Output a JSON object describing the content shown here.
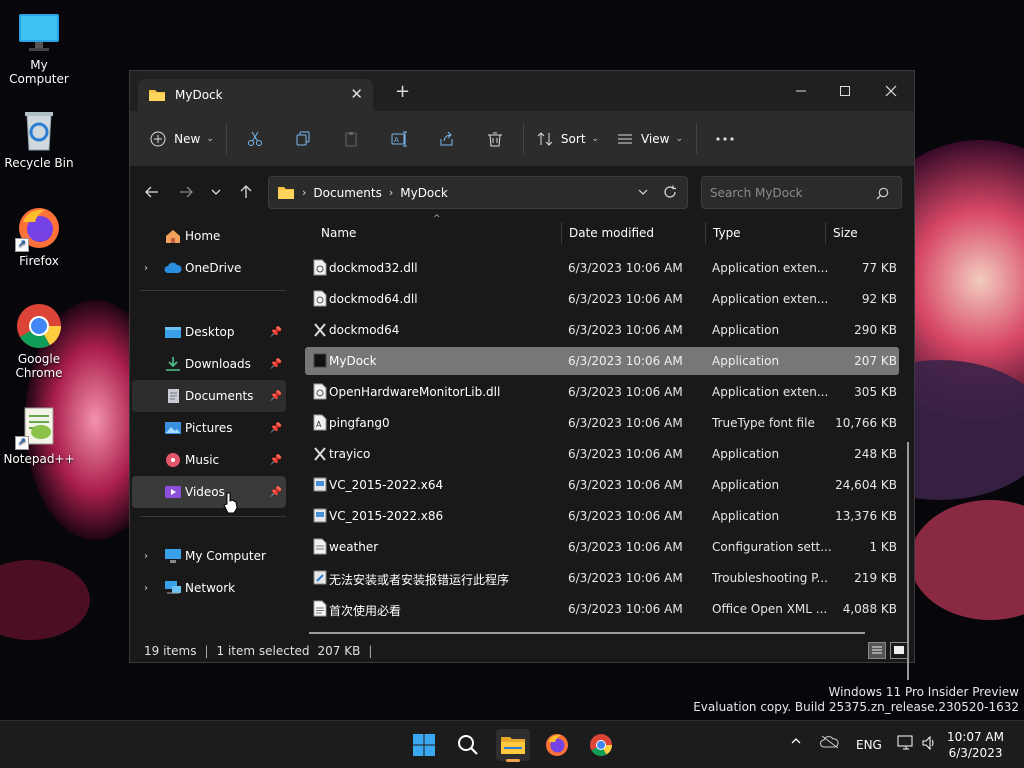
{
  "desktop": {
    "icons": [
      {
        "label": "My Computer"
      },
      {
        "label": "Recycle Bin"
      },
      {
        "label": "Firefox"
      },
      {
        "label": "Google Chrome"
      },
      {
        "label": "Notepad++"
      }
    ]
  },
  "window": {
    "tab_title": "MyDock",
    "toolbar": {
      "new_label": "New",
      "sort_label": "Sort",
      "view_label": "View"
    },
    "address": {
      "crumbs": [
        "Documents",
        "MyDock"
      ]
    },
    "search": {
      "placeholder": "Search MyDock"
    },
    "nav": {
      "home": "Home",
      "onedrive": "OneDrive",
      "desktop": "Desktop",
      "downloads": "Downloads",
      "documents": "Documents",
      "pictures": "Pictures",
      "music": "Music",
      "videos": "Videos",
      "my_computer": "My Computer",
      "network": "Network"
    },
    "columns": {
      "name": "Name",
      "date": "Date modified",
      "type": "Type",
      "size": "Size"
    },
    "files": [
      {
        "name": "dockmod32.dll",
        "date": "6/3/2023 10:06 AM",
        "type": "Application exten...",
        "size": "77 KB",
        "icon": "dll-icon"
      },
      {
        "name": "dockmod64.dll",
        "date": "6/3/2023 10:06 AM",
        "type": "Application exten...",
        "size": "92 KB",
        "icon": "dll-icon"
      },
      {
        "name": "dockmod64",
        "date": "6/3/2023 10:06 AM",
        "type": "Application",
        "size": "290 KB",
        "icon": "tools-icon"
      },
      {
        "name": "MyDock",
        "date": "6/3/2023 10:06 AM",
        "type": "Application",
        "size": "207 KB",
        "icon": "app-icon"
      },
      {
        "name": "OpenHardwareMonitorLib.dll",
        "date": "6/3/2023 10:06 AM",
        "type": "Application exten...",
        "size": "305 KB",
        "icon": "dll-icon"
      },
      {
        "name": "pingfang0",
        "date": "6/3/2023 10:06 AM",
        "type": "TrueType font file",
        "size": "10,766 KB",
        "icon": "font-icon"
      },
      {
        "name": "trayico",
        "date": "6/3/2023 10:06 AM",
        "type": "Application",
        "size": "248 KB",
        "icon": "tools-icon"
      },
      {
        "name": "VC_2015-2022.x64",
        "date": "6/3/2023 10:06 AM",
        "type": "Application",
        "size": "24,604 KB",
        "icon": "installer-icon"
      },
      {
        "name": "VC_2015-2022.x86",
        "date": "6/3/2023 10:06 AM",
        "type": "Application",
        "size": "13,376 KB",
        "icon": "installer-icon"
      },
      {
        "name": "weather",
        "date": "6/3/2023 10:06 AM",
        "type": "Configuration sett...",
        "size": "1 KB",
        "icon": "config-icon"
      },
      {
        "name": "无法安装或者安装报错运行此程序",
        "date": "6/3/2023 10:06 AM",
        "type": "Troubleshooting P...",
        "size": "219 KB",
        "icon": "troubleshoot-icon"
      },
      {
        "name": "首次使用必看",
        "date": "6/3/2023 10:06 AM",
        "type": "Office Open XML ...",
        "size": "4,088 KB",
        "icon": "document-icon"
      }
    ],
    "selected_index": 3,
    "status": {
      "items": "19 items",
      "selected": "1 item selected",
      "selected_size": "207 KB"
    }
  },
  "watermark": {
    "line1": "Windows 11 Pro Insider Preview",
    "line2": "Evaluation copy. Build 25375.zn_release.230520-1632"
  },
  "taskbar": {
    "language": "ENG",
    "time": "10:07 AM",
    "date": "6/3/2023"
  },
  "colors": {
    "accent": "#f0a14a",
    "selection": "#777777",
    "window_bg": "#191919",
    "toolbar_bg": "#2c2c2c"
  }
}
